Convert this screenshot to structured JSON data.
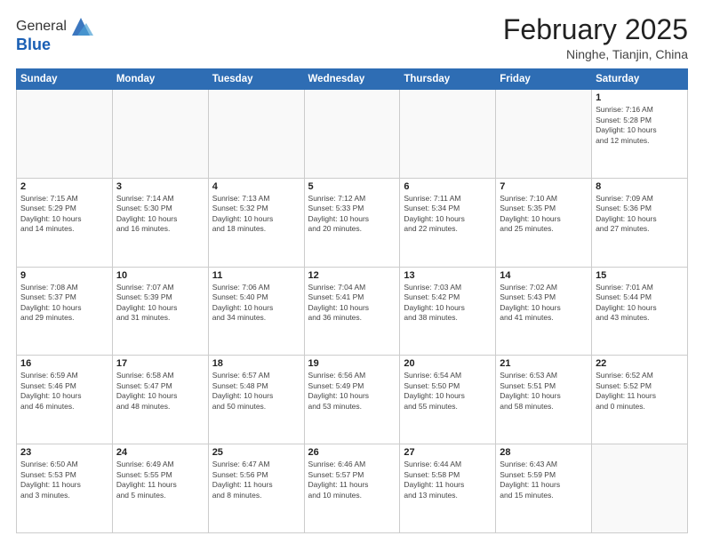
{
  "header": {
    "logo_line1": "General",
    "logo_line2": "Blue",
    "month_title": "February 2025",
    "location": "Ninghe, Tianjin, China"
  },
  "weekdays": [
    "Sunday",
    "Monday",
    "Tuesday",
    "Wednesday",
    "Thursday",
    "Friday",
    "Saturday"
  ],
  "weeks": [
    [
      {
        "day": "",
        "info": ""
      },
      {
        "day": "",
        "info": ""
      },
      {
        "day": "",
        "info": ""
      },
      {
        "day": "",
        "info": ""
      },
      {
        "day": "",
        "info": ""
      },
      {
        "day": "",
        "info": ""
      },
      {
        "day": "1",
        "info": "Sunrise: 7:16 AM\nSunset: 5:28 PM\nDaylight: 10 hours\nand 12 minutes."
      }
    ],
    [
      {
        "day": "2",
        "info": "Sunrise: 7:15 AM\nSunset: 5:29 PM\nDaylight: 10 hours\nand 14 minutes."
      },
      {
        "day": "3",
        "info": "Sunrise: 7:14 AM\nSunset: 5:30 PM\nDaylight: 10 hours\nand 16 minutes."
      },
      {
        "day": "4",
        "info": "Sunrise: 7:13 AM\nSunset: 5:32 PM\nDaylight: 10 hours\nand 18 minutes."
      },
      {
        "day": "5",
        "info": "Sunrise: 7:12 AM\nSunset: 5:33 PM\nDaylight: 10 hours\nand 20 minutes."
      },
      {
        "day": "6",
        "info": "Sunrise: 7:11 AM\nSunset: 5:34 PM\nDaylight: 10 hours\nand 22 minutes."
      },
      {
        "day": "7",
        "info": "Sunrise: 7:10 AM\nSunset: 5:35 PM\nDaylight: 10 hours\nand 25 minutes."
      },
      {
        "day": "8",
        "info": "Sunrise: 7:09 AM\nSunset: 5:36 PM\nDaylight: 10 hours\nand 27 minutes."
      }
    ],
    [
      {
        "day": "9",
        "info": "Sunrise: 7:08 AM\nSunset: 5:37 PM\nDaylight: 10 hours\nand 29 minutes."
      },
      {
        "day": "10",
        "info": "Sunrise: 7:07 AM\nSunset: 5:39 PM\nDaylight: 10 hours\nand 31 minutes."
      },
      {
        "day": "11",
        "info": "Sunrise: 7:06 AM\nSunset: 5:40 PM\nDaylight: 10 hours\nand 34 minutes."
      },
      {
        "day": "12",
        "info": "Sunrise: 7:04 AM\nSunset: 5:41 PM\nDaylight: 10 hours\nand 36 minutes."
      },
      {
        "day": "13",
        "info": "Sunrise: 7:03 AM\nSunset: 5:42 PM\nDaylight: 10 hours\nand 38 minutes."
      },
      {
        "day": "14",
        "info": "Sunrise: 7:02 AM\nSunset: 5:43 PM\nDaylight: 10 hours\nand 41 minutes."
      },
      {
        "day": "15",
        "info": "Sunrise: 7:01 AM\nSunset: 5:44 PM\nDaylight: 10 hours\nand 43 minutes."
      }
    ],
    [
      {
        "day": "16",
        "info": "Sunrise: 6:59 AM\nSunset: 5:46 PM\nDaylight: 10 hours\nand 46 minutes."
      },
      {
        "day": "17",
        "info": "Sunrise: 6:58 AM\nSunset: 5:47 PM\nDaylight: 10 hours\nand 48 minutes."
      },
      {
        "day": "18",
        "info": "Sunrise: 6:57 AM\nSunset: 5:48 PM\nDaylight: 10 hours\nand 50 minutes."
      },
      {
        "day": "19",
        "info": "Sunrise: 6:56 AM\nSunset: 5:49 PM\nDaylight: 10 hours\nand 53 minutes."
      },
      {
        "day": "20",
        "info": "Sunrise: 6:54 AM\nSunset: 5:50 PM\nDaylight: 10 hours\nand 55 minutes."
      },
      {
        "day": "21",
        "info": "Sunrise: 6:53 AM\nSunset: 5:51 PM\nDaylight: 10 hours\nand 58 minutes."
      },
      {
        "day": "22",
        "info": "Sunrise: 6:52 AM\nSunset: 5:52 PM\nDaylight: 11 hours\nand 0 minutes."
      }
    ],
    [
      {
        "day": "23",
        "info": "Sunrise: 6:50 AM\nSunset: 5:53 PM\nDaylight: 11 hours\nand 3 minutes."
      },
      {
        "day": "24",
        "info": "Sunrise: 6:49 AM\nSunset: 5:55 PM\nDaylight: 11 hours\nand 5 minutes."
      },
      {
        "day": "25",
        "info": "Sunrise: 6:47 AM\nSunset: 5:56 PM\nDaylight: 11 hours\nand 8 minutes."
      },
      {
        "day": "26",
        "info": "Sunrise: 6:46 AM\nSunset: 5:57 PM\nDaylight: 11 hours\nand 10 minutes."
      },
      {
        "day": "27",
        "info": "Sunrise: 6:44 AM\nSunset: 5:58 PM\nDaylight: 11 hours\nand 13 minutes."
      },
      {
        "day": "28",
        "info": "Sunrise: 6:43 AM\nSunset: 5:59 PM\nDaylight: 11 hours\nand 15 minutes."
      },
      {
        "day": "",
        "info": ""
      }
    ]
  ]
}
